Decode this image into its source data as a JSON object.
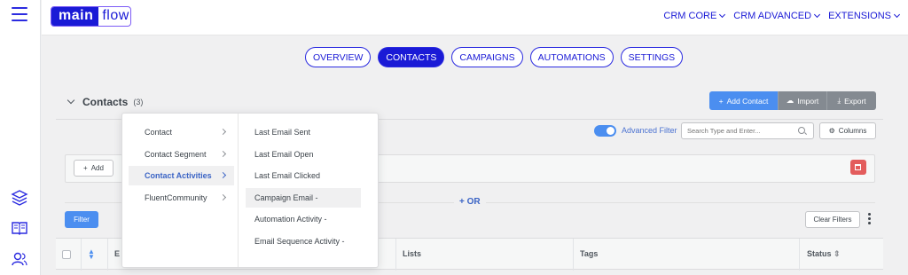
{
  "brand": {
    "logo_part1": "main",
    "logo_part2": "flow"
  },
  "topnav": [
    {
      "label": "CRM CORE"
    },
    {
      "label": "CRM ADVANCED"
    },
    {
      "label": "EXTENSIONS"
    }
  ],
  "tabs": [
    {
      "label": "OVERVIEW",
      "active": false
    },
    {
      "label": "CONTACTS",
      "active": true
    },
    {
      "label": "CAMPAIGNS",
      "active": false
    },
    {
      "label": "AUTOMATIONS",
      "active": false
    },
    {
      "label": "SETTINGS",
      "active": false
    }
  ],
  "contacts": {
    "title": "Contacts",
    "count": "(3)",
    "add_label": "Add Contact",
    "import_label": "Import",
    "export_label": "Export"
  },
  "filters": {
    "advanced_label": "Advanced Filter",
    "search_placeholder": "Search Type and Enter...",
    "columns_label": "Columns",
    "add_label": "Add",
    "or_label": "OR",
    "filter_label": "Filter",
    "clear_label": "Clear Filters"
  },
  "table": {
    "col_email_partial": "E",
    "col_lists": "Lists",
    "col_tags": "Tags",
    "col_status": "Status"
  },
  "dropdown": {
    "categories": [
      {
        "label": "Contact",
        "selected": false
      },
      {
        "label": "Contact Segment",
        "selected": false
      },
      {
        "label": "Contact Activities",
        "selected": true
      },
      {
        "label": "FluentCommunity",
        "selected": false
      }
    ],
    "options": [
      {
        "label": "Last Email Sent",
        "highlighted": false
      },
      {
        "label": "Last Email Open",
        "highlighted": false
      },
      {
        "label": "Last Email Clicked",
        "highlighted": false
      },
      {
        "label": "Campaign Email -",
        "highlighted": true
      },
      {
        "label": "Automation Activity -",
        "highlighted": false
      },
      {
        "label": "Email Sequence Activity -",
        "highlighted": false
      }
    ]
  },
  "colors": {
    "primary": "#1a1ad6",
    "accent_blue": "#4b8ef0",
    "danger": "#e35d5d",
    "neutral_button": "#848a91"
  }
}
